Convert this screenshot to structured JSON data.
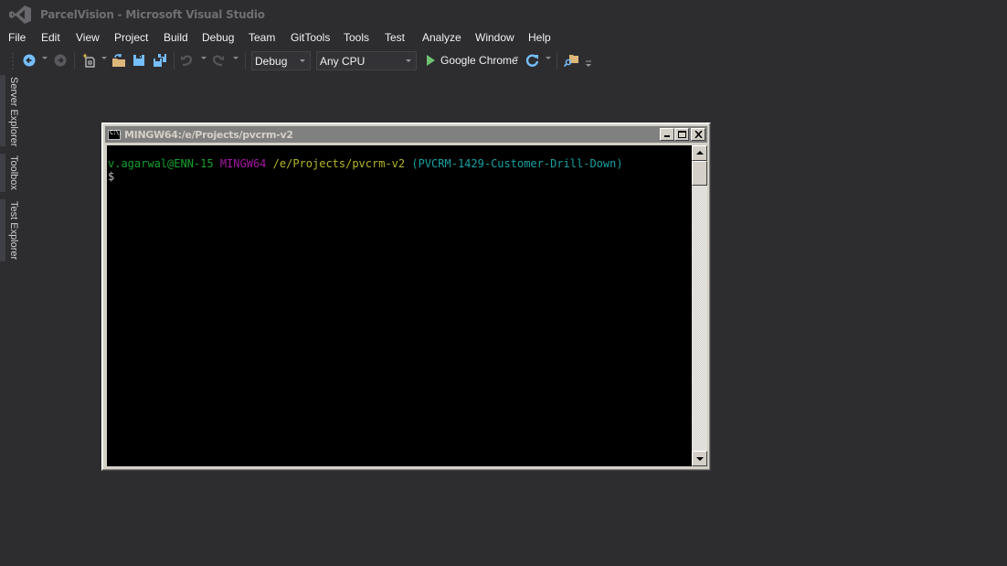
{
  "window": {
    "title": "ParcelVision - Microsoft Visual Studio",
    "logo_icon": "visual-studio-logo-icon"
  },
  "menu": [
    {
      "label": "File"
    },
    {
      "label": "Edit"
    },
    {
      "label": "View"
    },
    {
      "label": "Project"
    },
    {
      "label": "Build"
    },
    {
      "label": "Debug"
    },
    {
      "label": "Team"
    },
    {
      "label": "GitTools"
    },
    {
      "label": "Tools"
    },
    {
      "label": "Test"
    },
    {
      "label": "Analyze"
    },
    {
      "label": "Window"
    },
    {
      "label": "Help"
    }
  ],
  "toolbar": {
    "icons": [
      "navigate-back-icon",
      "navigate-forward-icon",
      "new-project-icon",
      "open-file-icon",
      "save-icon",
      "save-all-icon",
      "undo-icon",
      "redo-icon",
      "start-icon",
      "refresh-icon",
      "find-in-files-icon"
    ],
    "configuration": "Debug",
    "platform": "Any CPU",
    "run_target": "Google Chrome"
  },
  "side_tabs": [
    {
      "label": "Server Explorer"
    },
    {
      "label": "Toolbox"
    },
    {
      "label": "Test Explorer"
    }
  ],
  "console": {
    "title": "MINGW64:/e/Projects/pvcrm-v2",
    "icon_text": "C:\\.",
    "prompt": {
      "user_host": "v.agarwal@ENN-15",
      "system": "MINGW64",
      "path": "/e/Projects/pvcrm-v2",
      "branch": "(PVCRM-1429-Customer-Drill-Down)",
      "symbol": "$"
    },
    "buttons": {
      "minimize": "_",
      "maximize": "□",
      "close": "×"
    },
    "colors": {
      "user_host": "#16a12e",
      "system": "#a316a3",
      "path": "#b5b52a",
      "branch": "#16a1a3"
    }
  }
}
